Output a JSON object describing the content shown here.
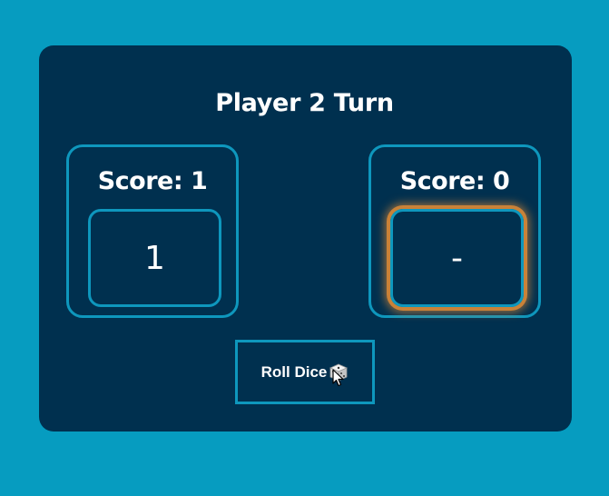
{
  "turn": {
    "title": "Player 2 Turn"
  },
  "players": [
    {
      "score_label": "Score: 1",
      "die_value": "1",
      "active": false
    },
    {
      "score_label": "Score: 0",
      "die_value": "-",
      "active": true
    }
  ],
  "controls": {
    "roll_label": "Roll Dice",
    "roll_icon": "dice-icon"
  },
  "colors": {
    "background": "#069cc0",
    "card": "#00304f",
    "border": "#0e97bd",
    "active_glow": "#c98238"
  }
}
